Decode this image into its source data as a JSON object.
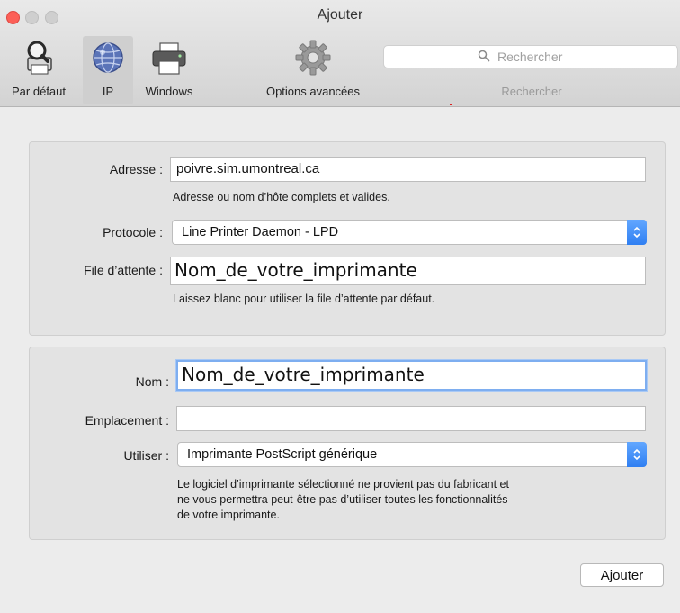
{
  "window": {
    "title": "Ajouter"
  },
  "toolbar": {
    "items": [
      {
        "label": "Par défaut",
        "icon": "magnifier-printer-icon"
      },
      {
        "label": "IP",
        "icon": "globe-icon",
        "selected": true
      },
      {
        "label": "Windows",
        "icon": "printer-icon"
      },
      {
        "label": "Options avancées",
        "icon": "gear-icon"
      }
    ],
    "search_placeholder": "Rechercher",
    "search_label": "Rechercher"
  },
  "ip_panel": {
    "address_label": "Adresse :",
    "address_value": "poivre.sim.umontreal.ca",
    "address_help": "Adresse ou nom d’hôte complets et valides.",
    "protocol_label": "Protocole :",
    "protocol_value": "Line Printer Daemon - LPD",
    "queue_label": "File d’attente :",
    "queue_value": "Nom_de_votre_imprimante",
    "queue_help": "Laissez blanc pour utiliser la file d’attente par défaut."
  },
  "details_panel": {
    "name_label": "Nom :",
    "name_value": "Nom_de_votre_imprimante",
    "location_label": "Emplacement :",
    "location_value": "",
    "use_label": "Utiliser :",
    "use_value": "Imprimante PostScript générique",
    "use_help_lines": [
      "Le logiciel d’imprimante sélectionné ne provient pas du fabricant et",
      "ne vous permettra peut-être pas d’utiliser toutes les fonctionnalités",
      "de votre imprimante."
    ]
  },
  "actions": {
    "add_button": "Ajouter"
  },
  "colors": {
    "accent": "#3b86f5",
    "close": "#fc5f57",
    "focus_ring": "#7eaef0"
  }
}
